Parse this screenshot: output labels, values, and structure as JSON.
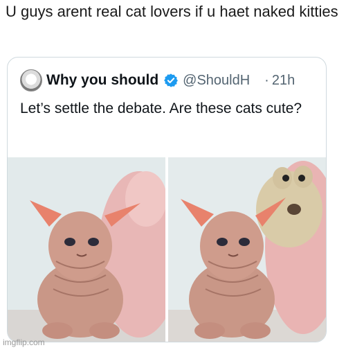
{
  "caption": "U guys arent real cat lovers if u haet naked kitties",
  "tweet": {
    "display_name": "Why you should",
    "handle": "@ShouldH",
    "separator": "·",
    "time": "21h",
    "text": "Let’s settle the debate. Are these cats cute?",
    "avatar_icon": "cat-avatar-icon",
    "verified_icon": "verified-badge-icon",
    "verified_color": "#1d9bf0"
  },
  "media": {
    "photos": [
      {
        "subject": "hairless-sphynx-kitten-with-pink-plush-toy"
      },
      {
        "subject": "hairless-sphynx-kitten-with-teddy-bear-toy"
      }
    ]
  },
  "watermark": "imgflip.com"
}
